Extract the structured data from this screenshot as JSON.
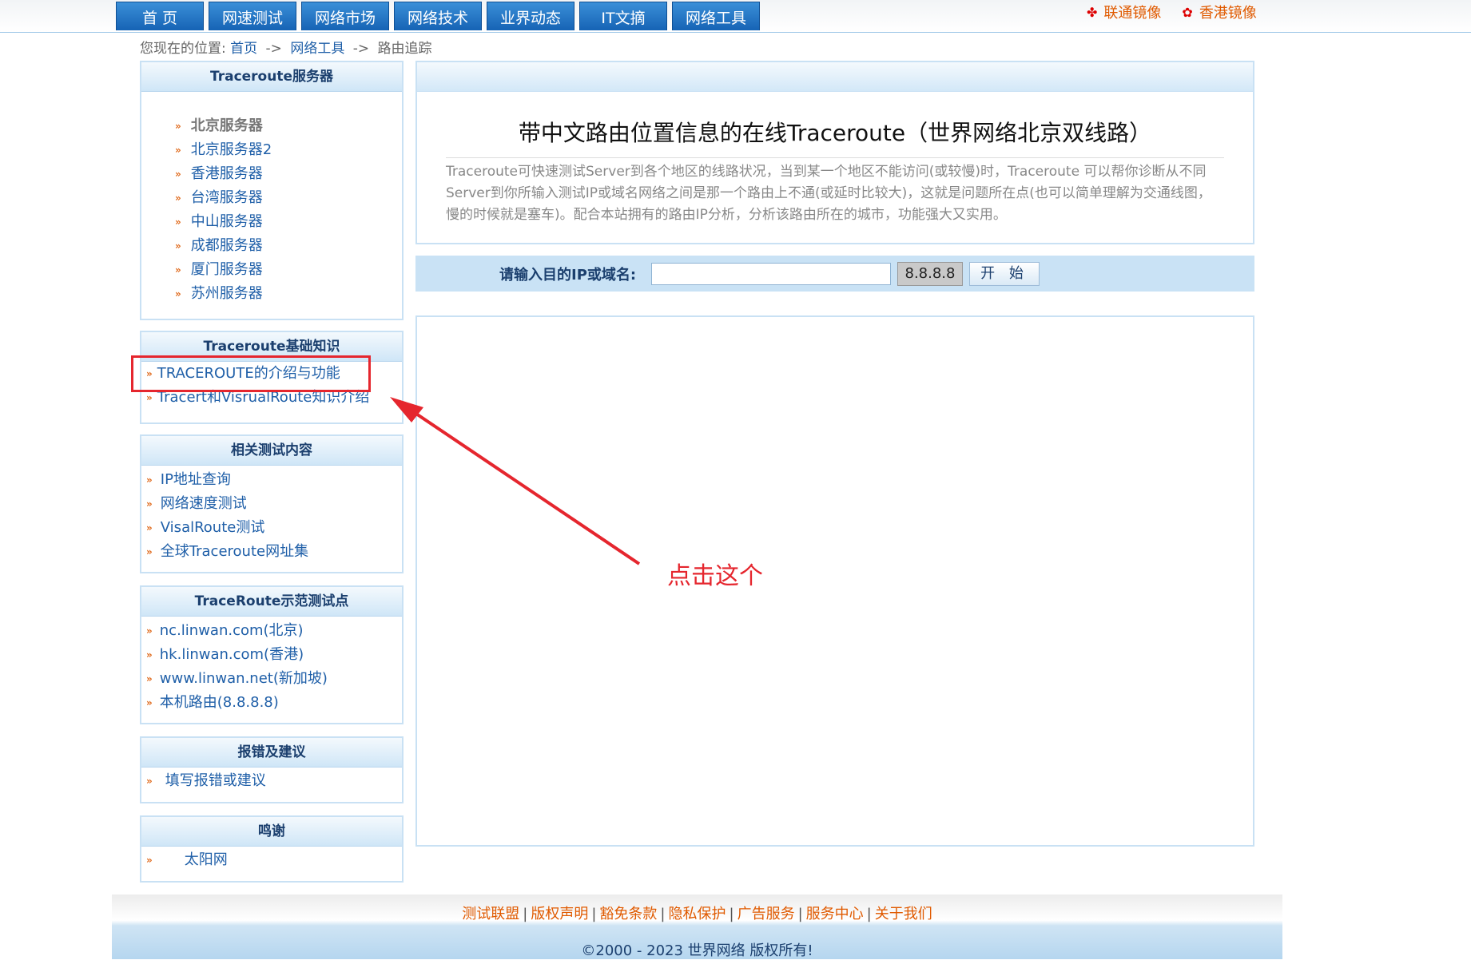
{
  "topnav": [
    "首 页",
    "网速测试",
    "网络市场",
    "网络技术",
    "业界动态",
    "IT文摘",
    "网络工具"
  ],
  "mirrors": {
    "unicom": "联通镜像",
    "hk": "香港镜像"
  },
  "breadcrumb": {
    "prefix": "您现在的位置:",
    "home": "首页",
    "sep": "->",
    "tools": "网络工具",
    "current": "路由追踪"
  },
  "servers": {
    "title": "Traceroute服务器",
    "items": [
      "北京服务器",
      "北京服务器2",
      "香港服务器",
      "台湾服务器",
      "中山服务器",
      "成都服务器",
      "厦门服务器",
      "苏州服务器"
    ]
  },
  "basics": {
    "title": "Traceroute基础知识",
    "items": [
      "TRACEROUTE的介绍与功能",
      "Tracert和VisrualRoute知识介绍"
    ]
  },
  "related": {
    "title": "相关测试内容",
    "items": [
      "IP地址查询",
      "网络速度测试",
      "VisalRoute测试",
      "全球Traceroute网址集"
    ]
  },
  "demo": {
    "title": "TraceRoute示范测试点",
    "items": [
      "nc.linwan.com(北京)",
      "hk.linwan.com(香港)",
      "www.linwan.net(新加坡)",
      "本机路由(8.8.8.8)"
    ]
  },
  "feedback": {
    "title": "报错及建议",
    "items": [
      "填写报错或建议"
    ]
  },
  "thanks": {
    "title": "鸣谢",
    "items": [
      "太阳网"
    ]
  },
  "intro": {
    "title": "带中文路由位置信息的在线Traceroute（世界网络北京双线路）",
    "desc": "Traceroute可快速测试Server到各个地区的线路状况，当到某一个地区不能访问(或较慢)时，Traceroute 可以帮你诊断从不同Server到你所输入测试IP或域名网络之间是那一个路由上不通(或延时比较大)，这就是问题所在点(也可以简单理解为交通线图，慢的时候就是塞车)。配合本站拥有的路由IP分析，分析该路由所在的城市，功能强大又实用。"
  },
  "search": {
    "label": "请输入目的IP或域名:",
    "value": "",
    "ip": "8.8.8.8",
    "start": "开 始"
  },
  "footer": {
    "links": [
      "测试联盟",
      "版权声明",
      "豁免条款",
      "隐私保护",
      "广告服务",
      "服务中心",
      "关于我们"
    ],
    "copyright": "©2000 - 2023 世界网络 版权所有!"
  },
  "annotation": {
    "text": "点击这个",
    "color": "#e5262e"
  },
  "colors": {
    "nav": "#1663b5",
    "link": "#1f5fa8",
    "orange": "#e05a00",
    "boxBorder": "#c9e1f4"
  }
}
